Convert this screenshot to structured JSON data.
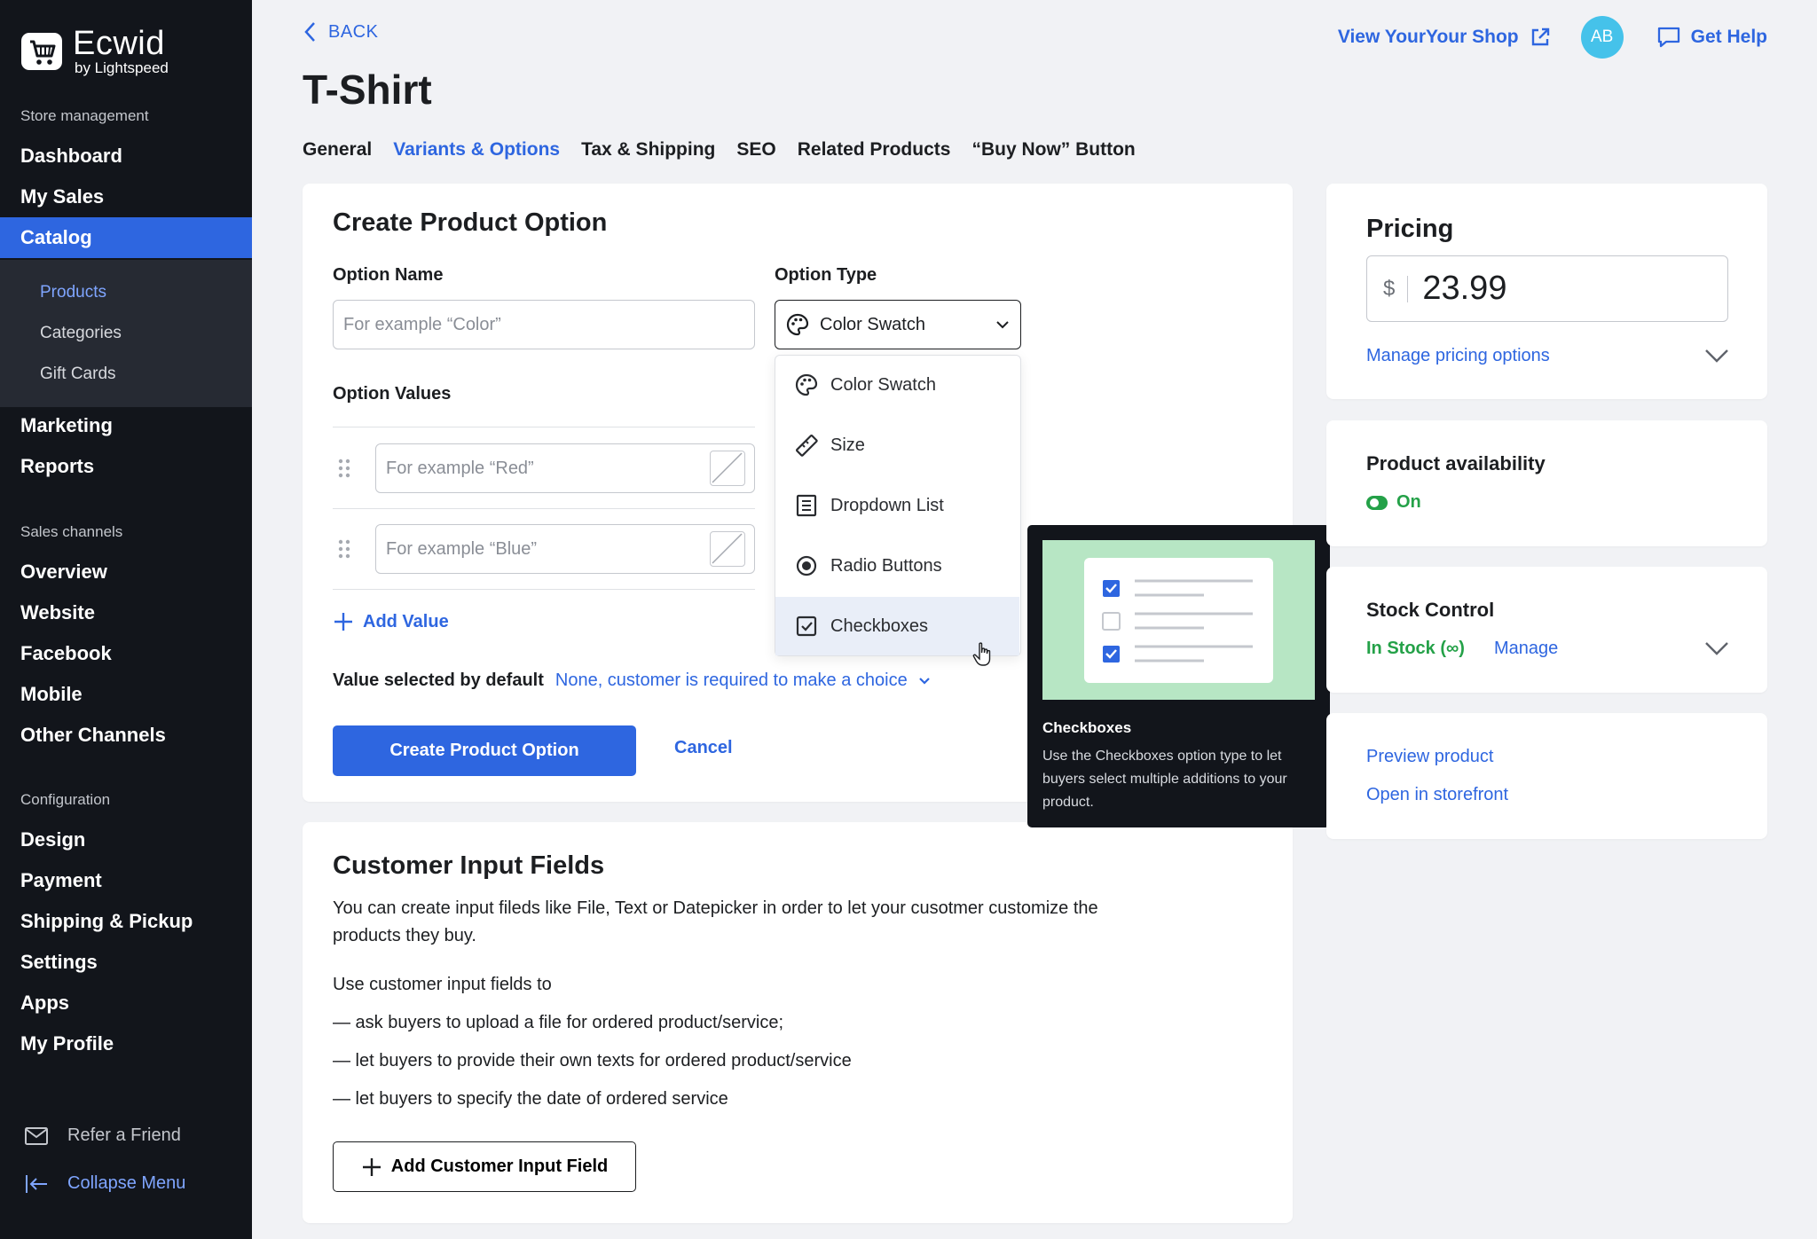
{
  "sidebar": {
    "logo_name": "Ecwid",
    "logo_sub": "by Lightspeed",
    "sections": {
      "store_management": "Store management",
      "sales_channels": "Sales channels",
      "configuration": "Configuration"
    },
    "store_items": [
      "Dashboard",
      "My Sales",
      "Catalog"
    ],
    "catalog_sub": [
      "Products",
      "Categories",
      "Gift Cards"
    ],
    "more_items": [
      "Marketing",
      "Reports"
    ],
    "channel_items": [
      "Overview",
      "Website",
      "Facebook",
      "Mobile",
      "Other Channels"
    ],
    "config_items": [
      "Design",
      "Payment",
      "Shipping & Pickup",
      "Settings",
      "Apps",
      "My Profile"
    ],
    "refer": "Refer a Friend",
    "collapse": "Collapse Menu"
  },
  "header": {
    "back": "BACK",
    "title": "T-Shirt",
    "view_shop": "View YourYour Shop",
    "avatar": "AB",
    "help": "Get Help"
  },
  "tabs": [
    "General",
    "Variants & Options",
    "Tax & Shipping",
    "SEO",
    "Related Products",
    "“Buy Now” Button"
  ],
  "option_form": {
    "title": "Create Product Option",
    "name_label": "Option Name",
    "name_placeholder": "For example “Color”",
    "type_label": "Option Type",
    "type_value": "Color Swatch",
    "values_label": "Option Values",
    "value_placeholders": [
      "For example “Red”",
      "For example “Blue”"
    ],
    "add_value": "Add Value",
    "default_label": "Value selected by default",
    "default_value": "None, customer is required to make a choice",
    "submit": "Create Product Option",
    "cancel": "Cancel"
  },
  "dropdown": {
    "options": [
      "Color Swatch",
      "Size",
      "Dropdown List",
      "Radio Buttons",
      "Checkboxes"
    ],
    "hovered": "Checkboxes"
  },
  "tooltip": {
    "title": "Checkboxes",
    "description": "Use the Checkboxes option type to let buyers select multiple additions to your product."
  },
  "input_fields": {
    "title": "Customer Input Fields",
    "intro": "You can create input fileds like File, Text or Datepicker in order to let your cusotmer customize the products they buy.",
    "use_label": "Use customer input fields to",
    "bullets": [
      "— ask buyers to upload a file for ordered product/service;",
      "— let buyers to provide their own texts for ordered product/service",
      "— let buyers to specify the date of ordered service"
    ],
    "add_button": "Add Customer Input Field"
  },
  "pricing": {
    "title": "Pricing",
    "currency": "$",
    "price": "23.99",
    "manage_link": "Manage pricing options"
  },
  "availability": {
    "title": "Product availability",
    "status": "On"
  },
  "stock": {
    "title": "Stock Control",
    "status": "In Stock (∞)",
    "manage": "Manage"
  },
  "links": {
    "preview": "Preview product",
    "storefront": "Open in storefront"
  },
  "colors": {
    "accent": "#2e66e0",
    "sidebar_bg": "#12151b",
    "success": "#24a148",
    "avatar": "#45c2ea"
  }
}
